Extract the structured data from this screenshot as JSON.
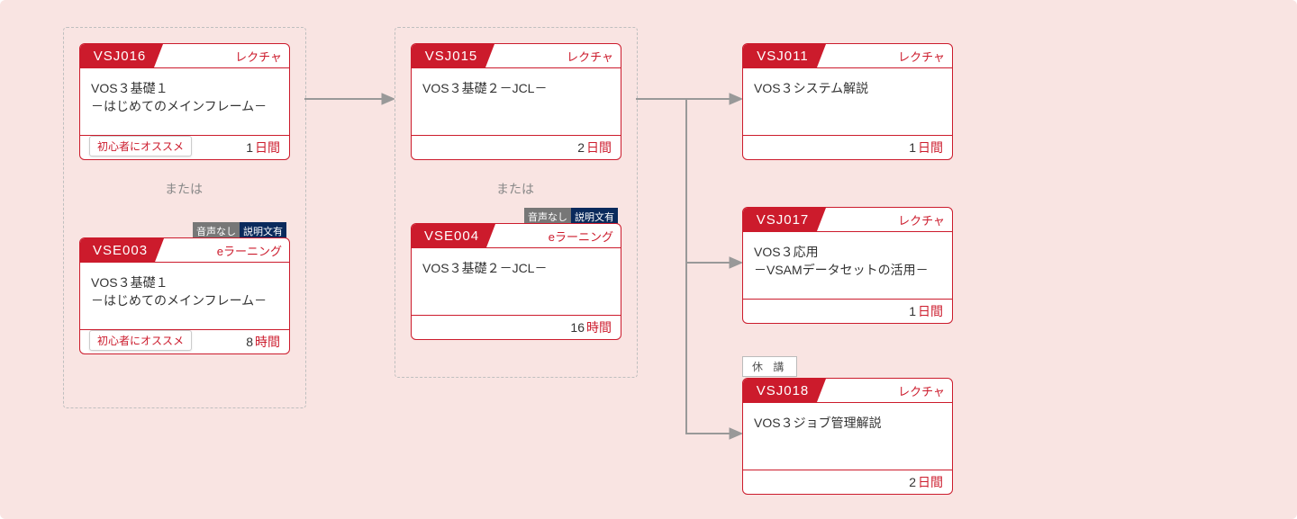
{
  "labels": {
    "or": "または",
    "audio_none": "音声なし",
    "has_desc": "説明文有",
    "suspended": "休 講"
  },
  "cards": {
    "c1": {
      "code": "VSJ016",
      "type": "レクチャ",
      "title": "VOS３基礎１\n－はじめてのメインフレーム－",
      "recommend": "初心者にオススメ",
      "dur_num": "1",
      "dur_unit": "日間"
    },
    "c2": {
      "code": "VSE003",
      "type": "eラーニング",
      "title": "VOS３基礎１\n－はじめてのメインフレーム－",
      "recommend": "初心者にオススメ",
      "dur_num": "8",
      "dur_unit": "時間"
    },
    "c3": {
      "code": "VSJ015",
      "type": "レクチャ",
      "title": "VOS３基礎２－JCL－",
      "dur_num": "2",
      "dur_unit": "日間"
    },
    "c4": {
      "code": "VSE004",
      "type": "eラーニング",
      "title": "VOS３基礎２－JCL－",
      "dur_num": "16",
      "dur_unit": "時間"
    },
    "c5": {
      "code": "VSJ011",
      "type": "レクチャ",
      "title": "VOS３システム解説",
      "dur_num": "1",
      "dur_unit": "日間"
    },
    "c6": {
      "code": "VSJ017",
      "type": "レクチャ",
      "title": "VOS３応用\n－VSAMデータセットの活用－",
      "dur_num": "1",
      "dur_unit": "日間"
    },
    "c7": {
      "code": "VSJ018",
      "type": "レクチャ",
      "title": "VOS３ジョブ管理解説",
      "dur_num": "2",
      "dur_unit": "日間"
    }
  }
}
